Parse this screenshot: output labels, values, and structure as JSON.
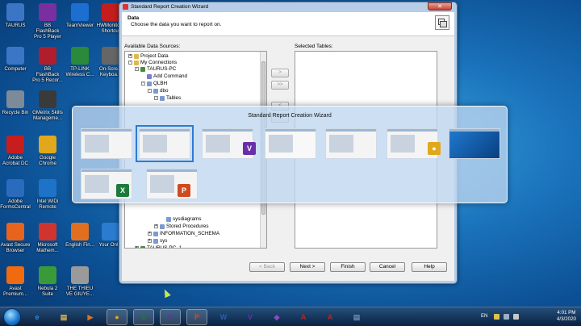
{
  "desktop": {
    "icons": [
      {
        "label": "TAURUS",
        "icon": "computer-icon",
        "color": "#3b76c6"
      },
      {
        "label": "BB FlashBack Pro 5 Player",
        "icon": "film-player-icon",
        "color": "#7a2fa0"
      },
      {
        "label": "TeamViewer",
        "icon": "teamviewer-icon",
        "color": "#1c6fd1"
      },
      {
        "label": "HWMonitor - Shortcut",
        "icon": "hwmonitor-icon",
        "color": "#c41d1d"
      },
      {
        "label": "Computer",
        "icon": "computer-icon",
        "color": "#3b76c6"
      },
      {
        "label": "BB FlashBack Pro 5 Recor...",
        "icon": "film-recorder-icon",
        "color": "#b01d2d"
      },
      {
        "label": "TP-LINK Wireless C...",
        "icon": "wifi-icon",
        "color": "#2a8a3a"
      },
      {
        "label": "On-Scre... Keyboa...",
        "icon": "keyboard-icon",
        "color": "#666666"
      },
      {
        "label": "Recycle Bin",
        "icon": "recycle-bin-icon",
        "color": "#7c8a9a"
      },
      {
        "label": "GMetrix Skills Manageme...",
        "icon": "gmetrix-icon",
        "color": "#3a3a3a"
      },
      {
        "label": "Adobe Acrobat DC",
        "icon": "acrobat-icon",
        "color": "#c81d1d"
      },
      {
        "label": "Google Chrome",
        "icon": "chrome-icon",
        "color": "#e0a81a"
      },
      {
        "label": "Adobe FormsCentral",
        "icon": "forms-icon",
        "color": "#2b6bbd"
      },
      {
        "label": "Intel WiDi Remote",
        "icon": "intel-icon",
        "color": "#1e73c8"
      },
      {
        "label": "Avast Secure Browser",
        "icon": "avast-browser-icon",
        "color": "#e8641c"
      },
      {
        "label": "Microsoft Mathem...",
        "icon": "math-icon",
        "color": "#d1342e"
      },
      {
        "label": "English Fin...",
        "icon": "english-icon",
        "color": "#e07020"
      },
      {
        "label": "Avast Premium...",
        "icon": "avast-icon",
        "color": "#f06a10"
      },
      {
        "label": "Nebula 2 Suite",
        "icon": "nebula-icon",
        "color": "#3a9a3a"
      },
      {
        "label": "THE THIEU VE GIUYE...",
        "icon": "document-icon",
        "color": "#9a9a9a"
      },
      {
        "label": "Your Onl...",
        "icon": "globe-icon",
        "color": "#2b7bd1"
      }
    ]
  },
  "wizard": {
    "title": "Standard Report Creation Wizard",
    "close_glyph": "✕",
    "header_title": "Data",
    "header_subtitle": "Choose the data you want to report on.",
    "available_label": "Available Data Sources:",
    "selected_label": "Selected Tables:",
    "tree": [
      {
        "label": "Project Data",
        "exp": "+",
        "icon_color": "#e0b84a"
      },
      {
        "label": "My Connections",
        "exp": "-",
        "icon_color": "#e0b84a"
      },
      {
        "label": "TAURUS-PC",
        "exp": "-",
        "icon_color": "#4a8a3a"
      },
      {
        "label": "Add Command",
        "exp": "",
        "icon_color": "#7a7ad0"
      },
      {
        "label": "QLBH",
        "exp": "-",
        "icon_color": "#7a9ad0"
      },
      {
        "label": "dbo",
        "exp": "-",
        "icon_color": "#7a9ad0"
      },
      {
        "label": "Tables",
        "exp": "-",
        "icon_color": "#7a9ad0"
      },
      {
        "label": "sysdiagrams",
        "exp": "",
        "icon_color": "#7a9ad0"
      },
      {
        "label": "Stored Procedures",
        "exp": "+",
        "icon_color": "#7a9ad0"
      },
      {
        "label": "INFORMATION_SCHEMA",
        "exp": "+",
        "icon_color": "#7a9ad0"
      },
      {
        "label": "sys",
        "exp": "+",
        "icon_color": "#7a9ad0"
      },
      {
        "label": "TAURUS-PC_1",
        "exp": "+",
        "icon_color": "#4a8a3a"
      }
    ],
    "move_buttons": [
      ">",
      ">>",
      "<",
      "<<"
    ],
    "buttons": {
      "back": "< Back",
      "next": "Next >",
      "finish": "Finish",
      "cancel": "Cancel",
      "help": "Help"
    }
  },
  "switcher": {
    "title": "Standard Report Creation Wizard",
    "windows": [
      {
        "name": "desktop-window",
        "badge": "",
        "badge_color": ""
      },
      {
        "name": "report-wizard-window",
        "badge": "",
        "badge_color": ""
      },
      {
        "name": "visual-studio-window",
        "badge": "V",
        "badge_color": "#6a2fa8"
      },
      {
        "name": "notepad-window",
        "badge": "",
        "badge_color": ""
      },
      {
        "name": "explorer-window",
        "badge": "",
        "badge_color": ""
      },
      {
        "name": "chrome-window",
        "badge": "●",
        "badge_color": "#e0a81a"
      },
      {
        "name": "windows-desktop-window",
        "badge": "",
        "badge_color": ""
      },
      {
        "name": "excel-window",
        "badge": "X",
        "badge_color": "#1e7a3a"
      },
      {
        "name": "powerpoint-window",
        "badge": "P",
        "badge_color": "#d04a1e"
      }
    ]
  },
  "taskbar": {
    "apps": [
      {
        "name": "ie",
        "glyph": "e",
        "color": "#2a8be0",
        "open": false
      },
      {
        "name": "file-explorer",
        "glyph": "▤",
        "color": "#e0b84a",
        "open": false
      },
      {
        "name": "media-player",
        "glyph": "▶",
        "color": "#e07020",
        "open": false
      },
      {
        "name": "chrome",
        "glyph": "●",
        "color": "#e0a81a",
        "open": true
      },
      {
        "name": "excel",
        "glyph": "X",
        "color": "#1e7a3a",
        "open": true
      },
      {
        "name": "visual-studio",
        "glyph": "V",
        "color": "#6a2fa8",
        "open": true
      },
      {
        "name": "powerpoint",
        "glyph": "P",
        "color": "#d04a1e",
        "open": true
      },
      {
        "name": "word",
        "glyph": "W",
        "color": "#2b5fb0",
        "open": false
      },
      {
        "name": "visual-studio-2",
        "glyph": "V",
        "color": "#6a2fa8",
        "open": false
      },
      {
        "name": "shield-app",
        "glyph": "◆",
        "color": "#8a4ac0",
        "open": false
      },
      {
        "name": "acrobat",
        "glyph": "A",
        "color": "#c81d1d",
        "open": false
      },
      {
        "name": "acrobat-2",
        "glyph": "A",
        "color": "#c81d1d",
        "open": false
      },
      {
        "name": "explorer-2",
        "glyph": "▤",
        "color": "#6a8ab0",
        "open": false
      }
    ],
    "language": "EN",
    "time": "4:01 PM",
    "date": "4/3/2020"
  }
}
